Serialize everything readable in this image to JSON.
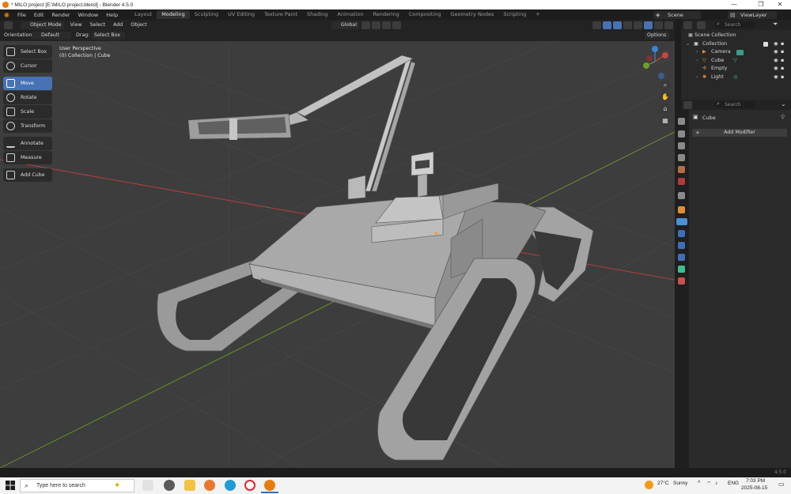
{
  "window": {
    "title": "* MILO project [E:\\MILO project.blend] - Blender 4.5.0",
    "controls": [
      "—",
      "❐",
      "✕"
    ]
  },
  "menu": {
    "items": [
      "File",
      "Edit",
      "Render",
      "Window",
      "Help"
    ]
  },
  "workspaces": {
    "tabs": [
      "Layout",
      "Modeling",
      "Sculpting",
      "UV Editing",
      "Texture Paint",
      "Shading",
      "Animation",
      "Rendering",
      "Compositing",
      "Geometry Nodes",
      "Scripting"
    ],
    "active": "Modeling",
    "add": "+"
  },
  "scene": {
    "name": "Scene",
    "view_layer": "ViewLayer"
  },
  "header": {
    "mode": "Object Mode",
    "menus": [
      "View",
      "Select",
      "Add",
      "Object"
    ],
    "transform_orientation": "Global",
    "options": "Options"
  },
  "header2": {
    "orientation_label": "Orientation:",
    "orientation_value": "Default",
    "drag_label": "Drag:",
    "drag_value": "Select Box"
  },
  "toolbar": {
    "tools": [
      "Select Box",
      "Cursor",
      "Move",
      "Rotate",
      "Scale",
      "Transform",
      "Annotate",
      "Measure",
      "Add Cube"
    ],
    "active": "Move"
  },
  "viewport_info": {
    "line1": "User Perspective",
    "line2": "(0) Collection | Cube"
  },
  "gizmo": {
    "x": "X",
    "y": "Y",
    "z": "Z"
  },
  "outliner": {
    "search_placeholder": "Search",
    "rows": [
      {
        "name": "Scene Collection",
        "level": 0
      },
      {
        "name": "Collection",
        "level": 1
      },
      {
        "name": "Camera",
        "level": 2
      },
      {
        "name": "Cube",
        "level": 2
      },
      {
        "name": "Empty",
        "level": 2
      },
      {
        "name": "Light",
        "level": 2
      }
    ]
  },
  "properties": {
    "search_placeholder": "Search",
    "object_name": "Cube",
    "add_modifier": "Add Modifier"
  },
  "statusbar": {
    "version": "4.5.0"
  },
  "taskbar": {
    "search_placeholder": "Type here to search",
    "weather_temp": "27°C",
    "weather_text": "Sunny",
    "lang": "ENG",
    "time": "7:03 PM",
    "date": "2025-08-15"
  },
  "colors": {
    "accent": "#4772b3",
    "viewport": "#3d3d3d",
    "panel": "#2b2b2b",
    "header": "#232323",
    "x_axis": "#c74545",
    "y_axis": "#6f9e2e",
    "z_axis": "#3d85d8"
  }
}
